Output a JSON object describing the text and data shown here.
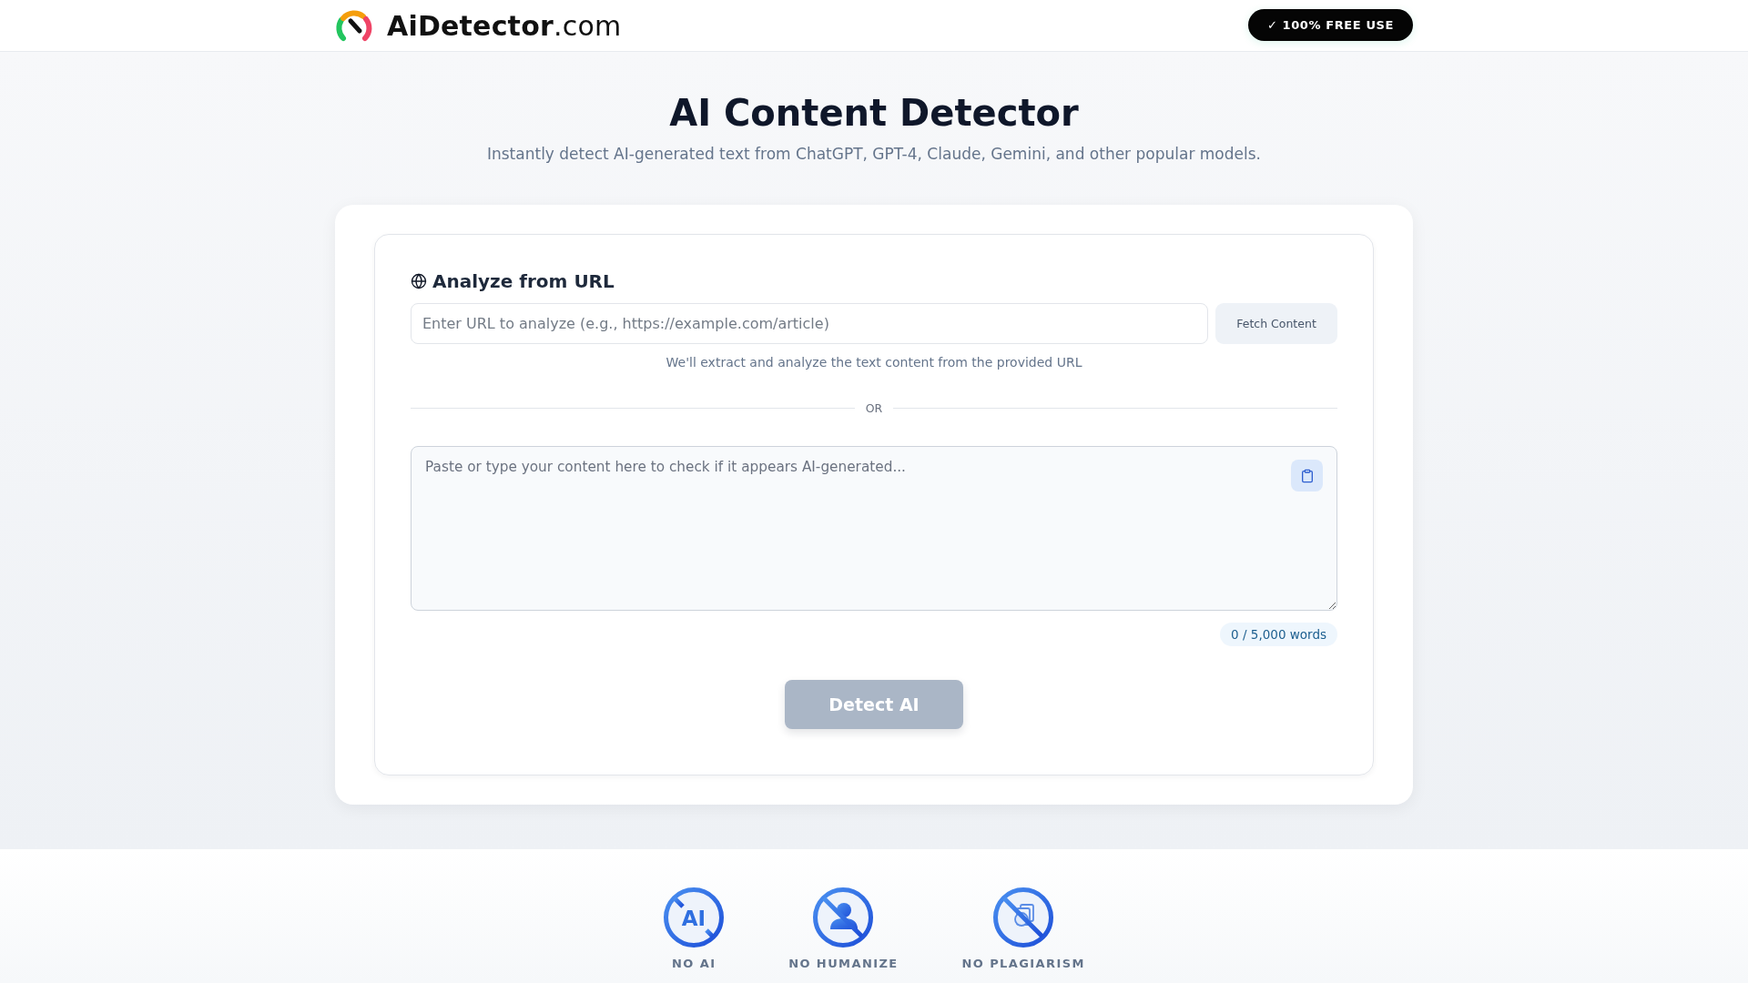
{
  "header": {
    "logo": "**AiDetector**.com",
    "badge": "✓ 100% FREE USE"
  },
  "hero": {
    "title": "AI Content Detector",
    "subtitle": "Instantly detect AI-generated text from ChatGPT, GPT-4, Claude, Gemini, and other popular models."
  },
  "url_section": {
    "heading": "Analyze from URL",
    "input": {
      "placeholder": "Enter URL to analyze (e.g., https://example.com/article)"
    },
    "button": "Fetch Content",
    "hint": "We'll extract and analyze the text content from the provided URL"
  },
  "divider": "OR",
  "text_input": {
    "placeholder": "Paste or type your content here to check if it appears AI-generated..."
  },
  "word_count": "0 / 5,000 words",
  "detect_button": {
    "label": "Detect AI",
    "disabled": true
  },
  "features": [
    {
      "kind": "ai",
      "icon_text": "AI",
      "label": "NO AI"
    },
    {
      "kind": "person",
      "label": "NO HUMANIZE"
    },
    {
      "kind": "documents",
      "label": "NO PLAGIARISM"
    }
  ]
}
